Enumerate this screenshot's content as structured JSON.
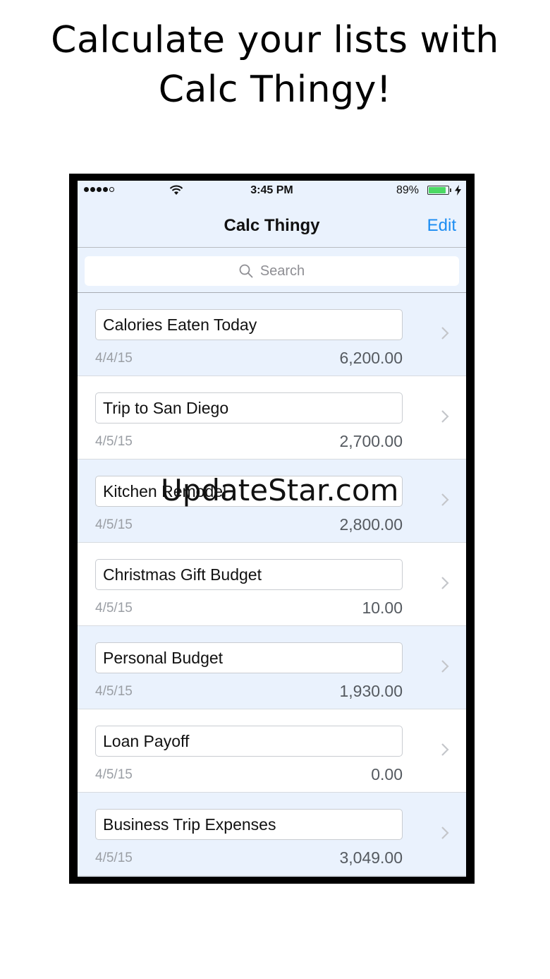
{
  "headline": {
    "line1": "Calculate your lists with",
    "line2": "Calc Thingy!"
  },
  "status_bar": {
    "time": "3:45 PM",
    "battery_percent_text": "89%",
    "battery_level": 0.89,
    "signal_bars_filled": 4,
    "signal_bars_total": 5
  },
  "nav": {
    "title": "Calc Thingy",
    "edit_label": "Edit"
  },
  "search": {
    "placeholder": "Search"
  },
  "lists": [
    {
      "name": "Calories Eaten Today",
      "date": "4/4/15",
      "amount": "6,200.00"
    },
    {
      "name": "Trip to San Diego",
      "date": "4/5/15",
      "amount": "2,700.00"
    },
    {
      "name": "Kitchen Remodel",
      "date": "4/5/15",
      "amount": "2,800.00"
    },
    {
      "name": "Christmas Gift Budget",
      "date": "4/5/15",
      "amount": "10.00"
    },
    {
      "name": "Personal Budget",
      "date": "4/5/15",
      "amount": "1,930.00"
    },
    {
      "name": "Loan Payoff",
      "date": "4/5/15",
      "amount": "0.00"
    },
    {
      "name": "Business Trip Expenses",
      "date": "4/5/15",
      "amount": "3,049.00"
    }
  ],
  "watermark": "UpdateStar.com",
  "colors": {
    "accent": "#1b8cf2",
    "battery": "#4cd964",
    "row_alt": "#eaf2fd"
  },
  "icons": {
    "search": "search-icon",
    "chevron": "chevron-right-icon",
    "wifi": "wifi-icon",
    "charging": "bolt-icon"
  }
}
